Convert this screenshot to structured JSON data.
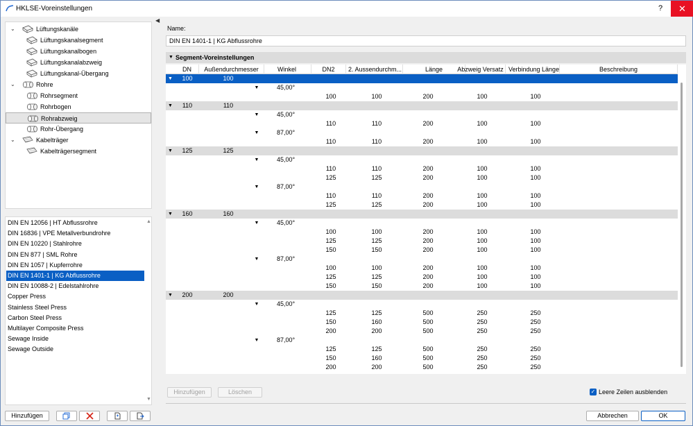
{
  "window": {
    "title": "HKLSE-Voreinstellungen",
    "help": "?",
    "close": "✕"
  },
  "tree": [
    {
      "label": "Lüftungskanäle",
      "level": 0,
      "expanded": true
    },
    {
      "label": "Lüftungskanalsegment",
      "level": 1
    },
    {
      "label": "Lüftungskanalbogen",
      "level": 1
    },
    {
      "label": "Lüftungskanalabzweig",
      "level": 1
    },
    {
      "label": "Lüftungskanal-Übergang",
      "level": 1
    },
    {
      "label": "Rohre",
      "level": 0,
      "expanded": true
    },
    {
      "label": "Rohrsegment",
      "level": 1
    },
    {
      "label": "Rohrbogen",
      "level": 1
    },
    {
      "label": "Rohrabzweig",
      "level": 1,
      "selected": true
    },
    {
      "label": "Rohr-Übergang",
      "level": 1
    },
    {
      "label": "Kabelträger",
      "level": 0,
      "expanded": true
    },
    {
      "label": "Kabelträgersegment",
      "level": 1
    }
  ],
  "list": [
    {
      "label": "DIN EN 12056 | HT Abflussrohre"
    },
    {
      "label": "DIN 16836 | VPE Metallverbundrohre"
    },
    {
      "label": "DIN EN 10220 | Stahlrohre"
    },
    {
      "label": "DIN EN 877 | SML Rohre"
    },
    {
      "label": "DIN EN 1057 | Kupferrohre"
    },
    {
      "label": "DIN EN 1401-1 | KG Abflussrohre",
      "selected": true
    },
    {
      "label": "DIN EN 10088-2 | Edelstahlrohre"
    },
    {
      "label": "Copper Press"
    },
    {
      "label": "Stainless Steel Press"
    },
    {
      "label": "Carbon Steel Press"
    },
    {
      "label": "Multilayer Composite Press"
    },
    {
      "label": "Sewage Inside"
    },
    {
      "label": "Sewage Outside"
    }
  ],
  "left_buttons": {
    "add": "Hinzufügen"
  },
  "name_label": "Name:",
  "name_value": "DIN EN 1401-1 | KG Abflussrohre",
  "section_title": "Segment-Voreinstellungen",
  "columns": [
    "DN",
    "Außendurchmesser",
    "Winkel",
    "DN2",
    "2. Aussendurchm...",
    "Länge",
    "Abzweig Versatz",
    "Verbindung Länge",
    "Beschreibung"
  ],
  "groups": [
    {
      "dn": "100",
      "od": "100",
      "selected": true,
      "angles": [
        {
          "angle": "45,00°",
          "rows": [
            [
              "100",
              "100",
              "200",
              "100",
              "100"
            ]
          ]
        }
      ]
    },
    {
      "dn": "110",
      "od": "110",
      "angles": [
        {
          "angle": "45,00°",
          "rows": [
            [
              "110",
              "110",
              "200",
              "100",
              "100"
            ]
          ]
        },
        {
          "angle": "87,00°",
          "rows": [
            [
              "110",
              "110",
              "200",
              "100",
              "100"
            ]
          ]
        }
      ]
    },
    {
      "dn": "125",
      "od": "125",
      "angles": [
        {
          "angle": "45,00°",
          "rows": [
            [
              "110",
              "110",
              "200",
              "100",
              "100"
            ],
            [
              "125",
              "125",
              "200",
              "100",
              "100"
            ]
          ]
        },
        {
          "angle": "87,00°",
          "rows": [
            [
              "110",
              "110",
              "200",
              "100",
              "100"
            ],
            [
              "125",
              "125",
              "200",
              "100",
              "100"
            ]
          ]
        }
      ]
    },
    {
      "dn": "160",
      "od": "160",
      "angles": [
        {
          "angle": "45,00°",
          "rows": [
            [
              "100",
              "100",
              "200",
              "100",
              "100"
            ],
            [
              "125",
              "125",
              "200",
              "100",
              "100"
            ],
            [
              "150",
              "150",
              "200",
              "100",
              "100"
            ]
          ]
        },
        {
          "angle": "87,00°",
          "rows": [
            [
              "100",
              "100",
              "200",
              "100",
              "100"
            ],
            [
              "125",
              "125",
              "200",
              "100",
              "100"
            ],
            [
              "150",
              "150",
              "200",
              "100",
              "100"
            ]
          ]
        }
      ]
    },
    {
      "dn": "200",
      "od": "200",
      "angles": [
        {
          "angle": "45,00°",
          "rows": [
            [
              "125",
              "125",
              "500",
              "250",
              "250"
            ],
            [
              "150",
              "160",
              "500",
              "250",
              "250"
            ],
            [
              "200",
              "200",
              "500",
              "250",
              "250"
            ]
          ]
        },
        {
          "angle": "87,00°",
          "rows": [
            [
              "125",
              "125",
              "500",
              "250",
              "250"
            ],
            [
              "150",
              "160",
              "500",
              "250",
              "250"
            ],
            [
              "200",
              "200",
              "500",
              "250",
              "250"
            ]
          ]
        }
      ]
    }
  ],
  "grid_buttons": {
    "add": "Hinzufügen",
    "delete": "Löschen"
  },
  "hide_empty": {
    "label": "Leere Zeilen ausblenden",
    "checked": true
  },
  "footer": {
    "cancel": "Abbrechen",
    "ok": "OK"
  }
}
